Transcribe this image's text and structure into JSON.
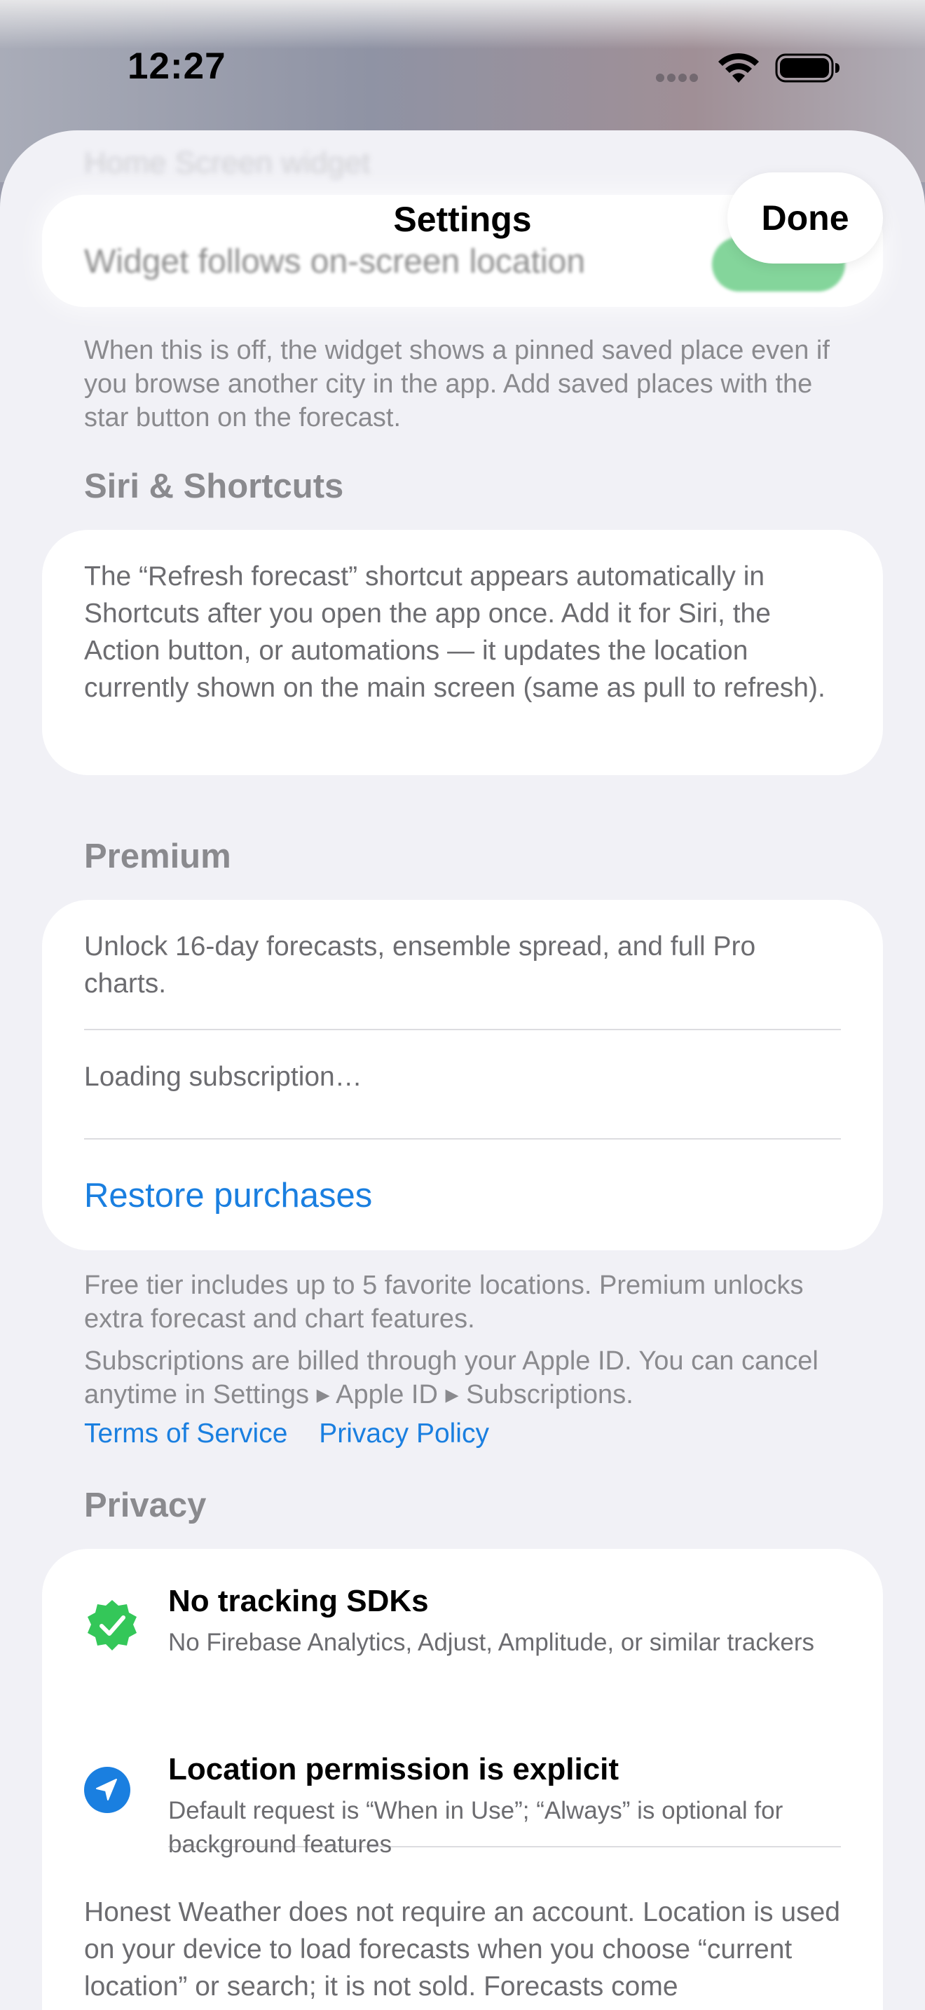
{
  "status_bar": {
    "time": "12:27"
  },
  "sheet": {
    "title": "Settings",
    "done_label": "Done",
    "background_heading": "Home Screen widget",
    "background_row_label": "Widget follows on-screen location"
  },
  "widget": {
    "toggle_on": true,
    "footnote": "When this is off, the widget shows a pinned saved place even if you browse another city in the app. Add saved places with the star button on the forecast."
  },
  "siri": {
    "heading": "Siri & Shortcuts",
    "body": "The “Refresh forecast” shortcut appears automatically in Shortcuts after you open the app once. Add it for Siri, the Action button, or automations — it updates the location currently shown on the main screen (same as pull to refresh)."
  },
  "premium": {
    "heading": "Premium",
    "description": "Unlock 16-day forecasts, ensemble spread, and full Pro charts.",
    "status": "Loading subscription…",
    "restore_label": "Restore purchases",
    "footnote_1": "Free tier includes up to 5 favorite locations. Premium unlocks extra forecast and chart features.",
    "footnote_2": "Subscriptions are billed through your Apple ID. You can cancel anytime in Settings ▸ Apple ID ▸ Subscriptions.",
    "terms_label": "Terms of Service",
    "privacy_label": "Privacy Policy"
  },
  "privacy": {
    "heading": "Privacy",
    "items": [
      {
        "title": "No tracking SDKs",
        "description": "No Firebase Analytics, Adjust, Amplitude, or similar trackers",
        "icon": "checkmark-seal-icon"
      },
      {
        "title": "Location permission is explicit",
        "description": "Default request is “When in Use”; “Always” is optional for background features",
        "icon": "location-arrow-icon"
      }
    ],
    "body": "Honest Weather does not require an account. Location is used on your device to load forecasts when you choose “current location” or search; it is not sold. Forecasts come"
  },
  "colors": {
    "accent": "#1A7FE0",
    "toggle_on": "#34C759",
    "check_badge": "#34C759",
    "sheet_background": "#F1F1F6",
    "secondary_text": "#8A8A8E"
  }
}
